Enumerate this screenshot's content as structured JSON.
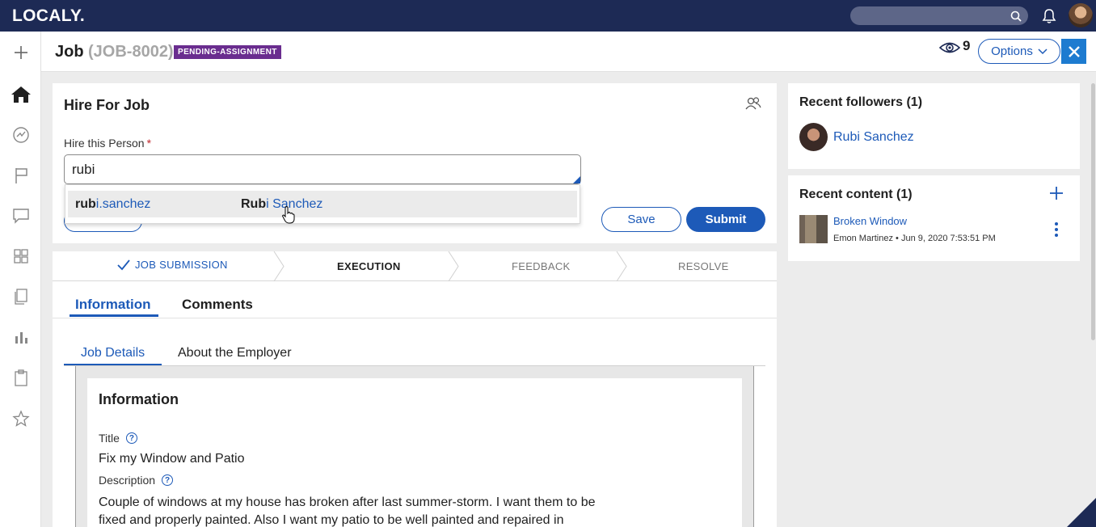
{
  "app": {
    "logo": "LOCALY."
  },
  "topbar": {
    "search_placeholder": ""
  },
  "header": {
    "title": "Job",
    "id": "(JOB-8002)",
    "status_badge": "PENDING-ASSIGNMENT",
    "watchers_count": "9",
    "options_label": "Options"
  },
  "hire_card": {
    "title": "Hire For Job",
    "field_label": "Hire this Person",
    "field_value": "rubi",
    "save_label": "Save",
    "submit_label": "Submit"
  },
  "dropdown": {
    "items": [
      {
        "username_match": "rub",
        "username_rest": "i.sanchez",
        "name_match": "Rub",
        "name_rest": "i Sanchez"
      }
    ]
  },
  "stepper": {
    "stages": [
      "JOB SUBMISSION",
      "EXECUTION",
      "FEEDBACK",
      "RESOLVE"
    ],
    "completed": [
      "JOB SUBMISSION"
    ],
    "active": "EXECUTION"
  },
  "tabs": {
    "information": "Information",
    "comments": "Comments"
  },
  "subtabs": {
    "job_details": "Job Details",
    "about_employer": "About the Employer"
  },
  "info_card": {
    "title": "Information",
    "title_label": "Title",
    "title_value": "Fix my Window and Patio",
    "desc_label": "Description",
    "desc_value": "Couple of windows at my house has broken after last summer-storm. I want them to be fixed and properly painted. Also I want my patio to be well painted and repaired in"
  },
  "followers": {
    "heading": "Recent followers (1)",
    "items": [
      {
        "name": "Rubi Sanchez"
      }
    ]
  },
  "recent_content": {
    "heading": "Recent content (1)",
    "items": [
      {
        "title": "Broken Window",
        "author": "Emon Martinez",
        "date": "Jun 9, 2020 7:53:51 PM"
      }
    ]
  },
  "colors": {
    "topbar": "#1d2a55",
    "accent": "#1d5ab8",
    "badge": "#6a2d8f",
    "close": "#1d7bd0"
  }
}
